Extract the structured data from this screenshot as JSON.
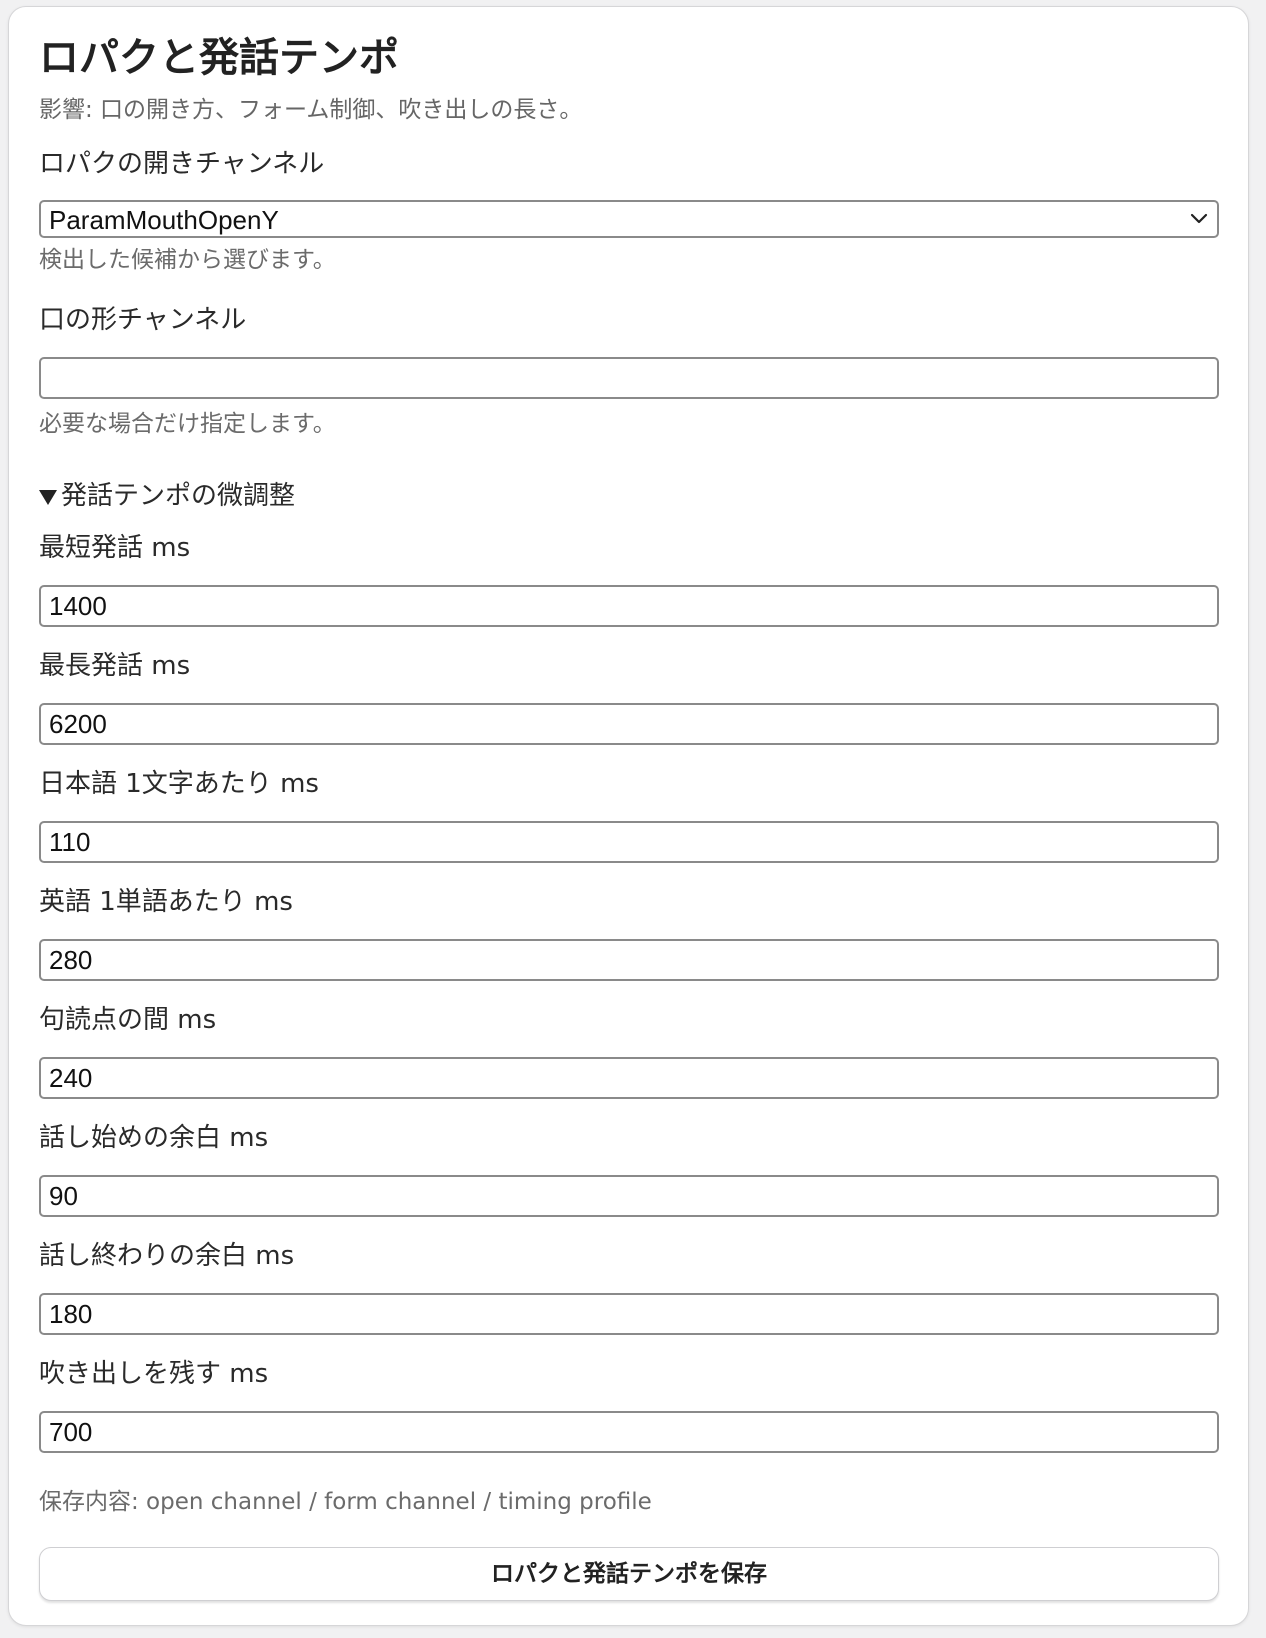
{
  "panel": {
    "title": "ロパクと発話テンポ",
    "subtitle": "影響: 口の開き方、フォーム制御、吹き出しの長さ。"
  },
  "open_channel": {
    "label": "ロパクの開きチャンネル",
    "selected": "ParamMouthOpenY",
    "hint": "検出した候補から選びます。"
  },
  "form_channel": {
    "label": "口の形チャンネル",
    "value": "",
    "hint": "必要な場合だけ指定します。"
  },
  "tempo_details": {
    "summary": "発話テンポの微調整",
    "expanded": true,
    "fields": [
      {
        "label": "最短発話 ms",
        "value": "1400"
      },
      {
        "label": "最長発話 ms",
        "value": "6200"
      },
      {
        "label": "日本語 1文字あたり ms",
        "value": "110"
      },
      {
        "label": "英語 1単語あたり ms",
        "value": "280"
      },
      {
        "label": "句読点の間 ms",
        "value": "240"
      },
      {
        "label": "話し始めの余白 ms",
        "value": "90"
      },
      {
        "label": "話し終わりの余白 ms",
        "value": "180"
      },
      {
        "label": "吹き出しを残す ms",
        "value": "700"
      }
    ]
  },
  "save_note": "保存内容: open channel / form channel / timing profile",
  "save_button": "ロパクと発話テンポを保存"
}
